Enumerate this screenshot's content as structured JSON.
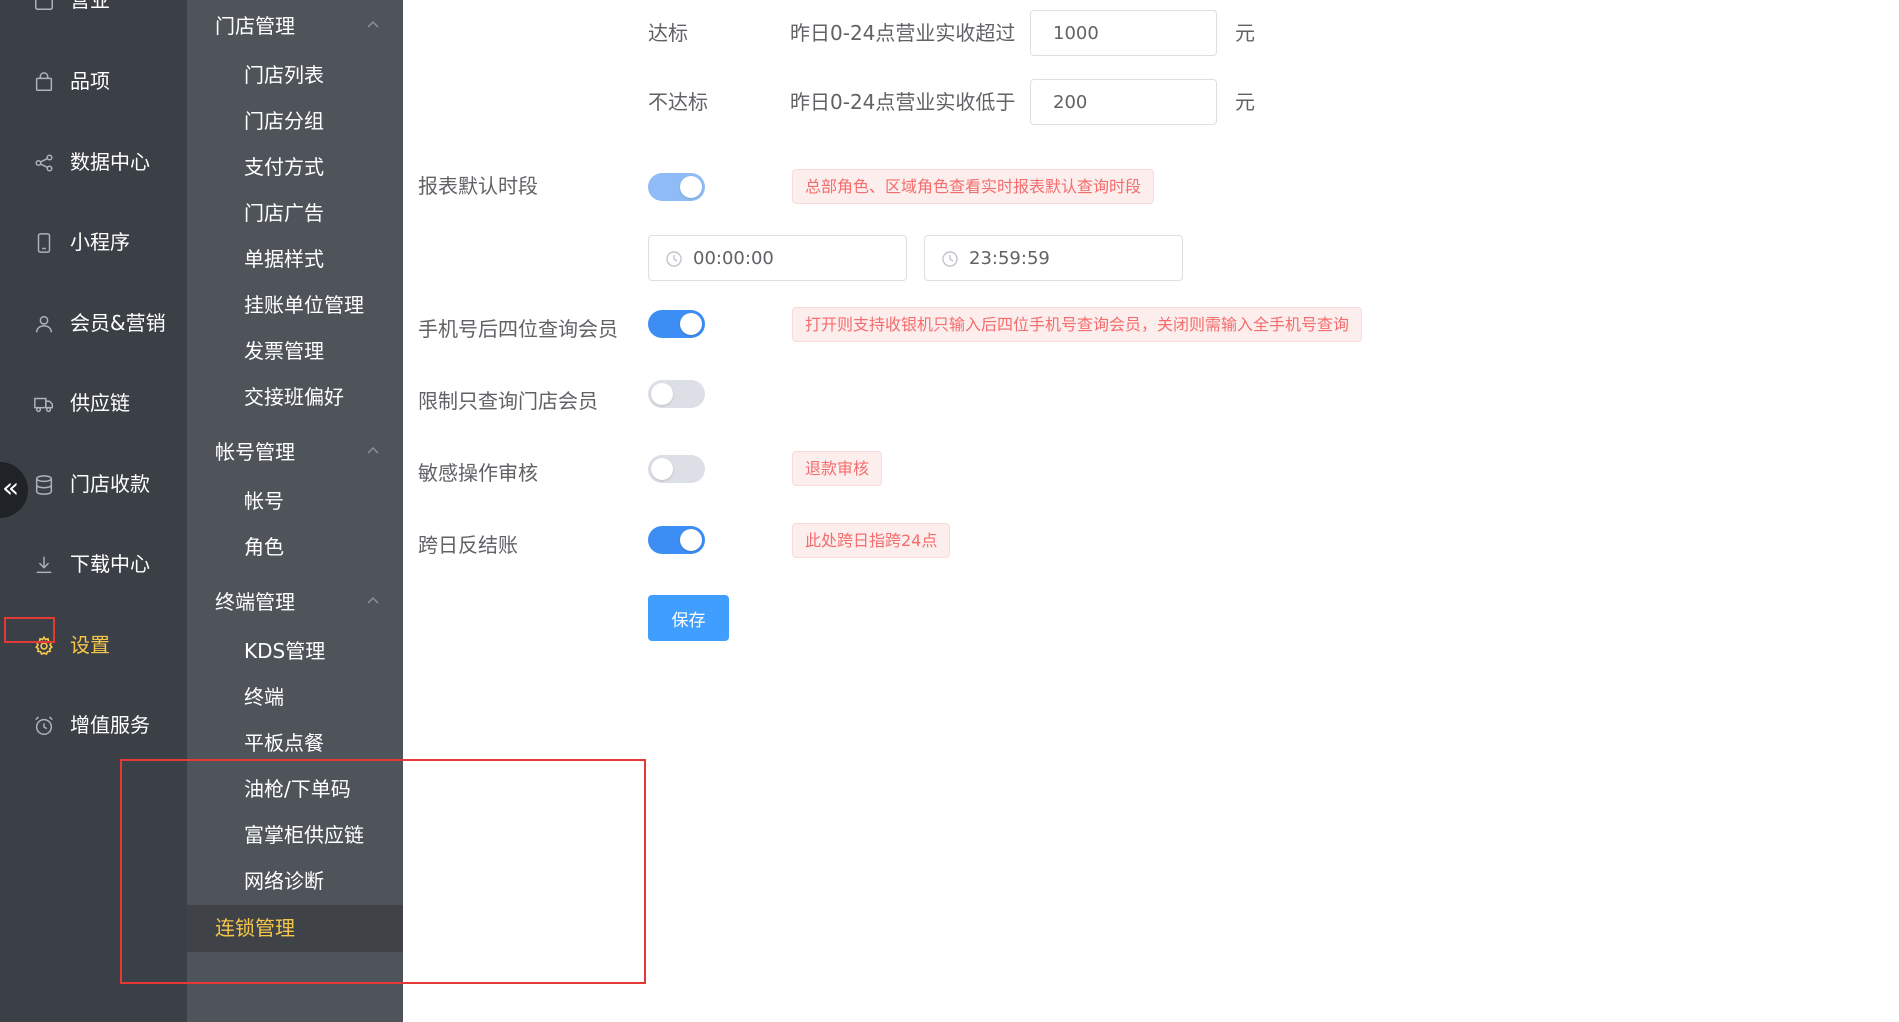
{
  "primary_nav": {
    "items": [
      {
        "label": "营业",
        "icon": "calendar-icon"
      },
      {
        "label": "品项",
        "icon": "bag-icon"
      },
      {
        "label": "数据中心",
        "icon": "share-icon"
      },
      {
        "label": "小程序",
        "icon": "phone-icon"
      },
      {
        "label": "会员&营销",
        "icon": "user-icon"
      },
      {
        "label": "供应链",
        "icon": "truck-icon"
      },
      {
        "label": "门店收款",
        "icon": "database-icon"
      },
      {
        "label": "下载中心",
        "icon": "download-icon"
      },
      {
        "label": "设置",
        "icon": "gear-icon",
        "active": true
      },
      {
        "label": "增值服务",
        "icon": "alarm-icon"
      }
    ],
    "collapse_glyph": "«"
  },
  "submenu": {
    "groups": [
      {
        "title": "门店管理",
        "items": [
          "门店列表",
          "门店分组",
          "支付方式",
          "门店广告",
          "单据样式",
          "挂账单位管理",
          "发票管理",
          "交接班偏好"
        ]
      },
      {
        "title": "帐号管理",
        "items": [
          "帐号",
          "角色"
        ]
      },
      {
        "title": "终端管理",
        "items": [
          "KDS管理",
          "终端",
          "平板点餐",
          "油枪/下单码",
          "富掌柜供应链",
          "网络诊断"
        ]
      }
    ],
    "active_item": "连锁管理"
  },
  "form": {
    "standard_row": {
      "label": "达标",
      "desc": "昨日0-24点营业实收超过",
      "value": "1000",
      "unit": "元"
    },
    "substandard_row": {
      "label": "不达标",
      "desc": "昨日0-24点营业实收低于",
      "value": "200",
      "unit": "元"
    },
    "report_period": {
      "label": "报表默认时段",
      "enabled": true,
      "hint": "总部角色、区域角色查看实时报表默认查询时段",
      "start_time": "00:00:00",
      "end_time": "23:59:59"
    },
    "phone_last4": {
      "label": "手机号后四位查询会员",
      "enabled": true,
      "hint": "打开则支持收银机只输入后四位手机号查询会员，关闭则需输入全手机号查询"
    },
    "store_member_only": {
      "label": "限制只查询门店会员",
      "enabled": false
    },
    "sensitive_audit": {
      "label": "敏感操作审核",
      "enabled": false,
      "hint": "退款审核"
    },
    "cross_day": {
      "label": "跨日反结账",
      "enabled": true,
      "hint": "此处跨日指跨24点"
    },
    "save_label": "保存"
  },
  "colors": {
    "primary": "#409eff",
    "active_nav": "#f5c64a",
    "hint_text": "#f56c6c",
    "annotation": "#e53935"
  }
}
